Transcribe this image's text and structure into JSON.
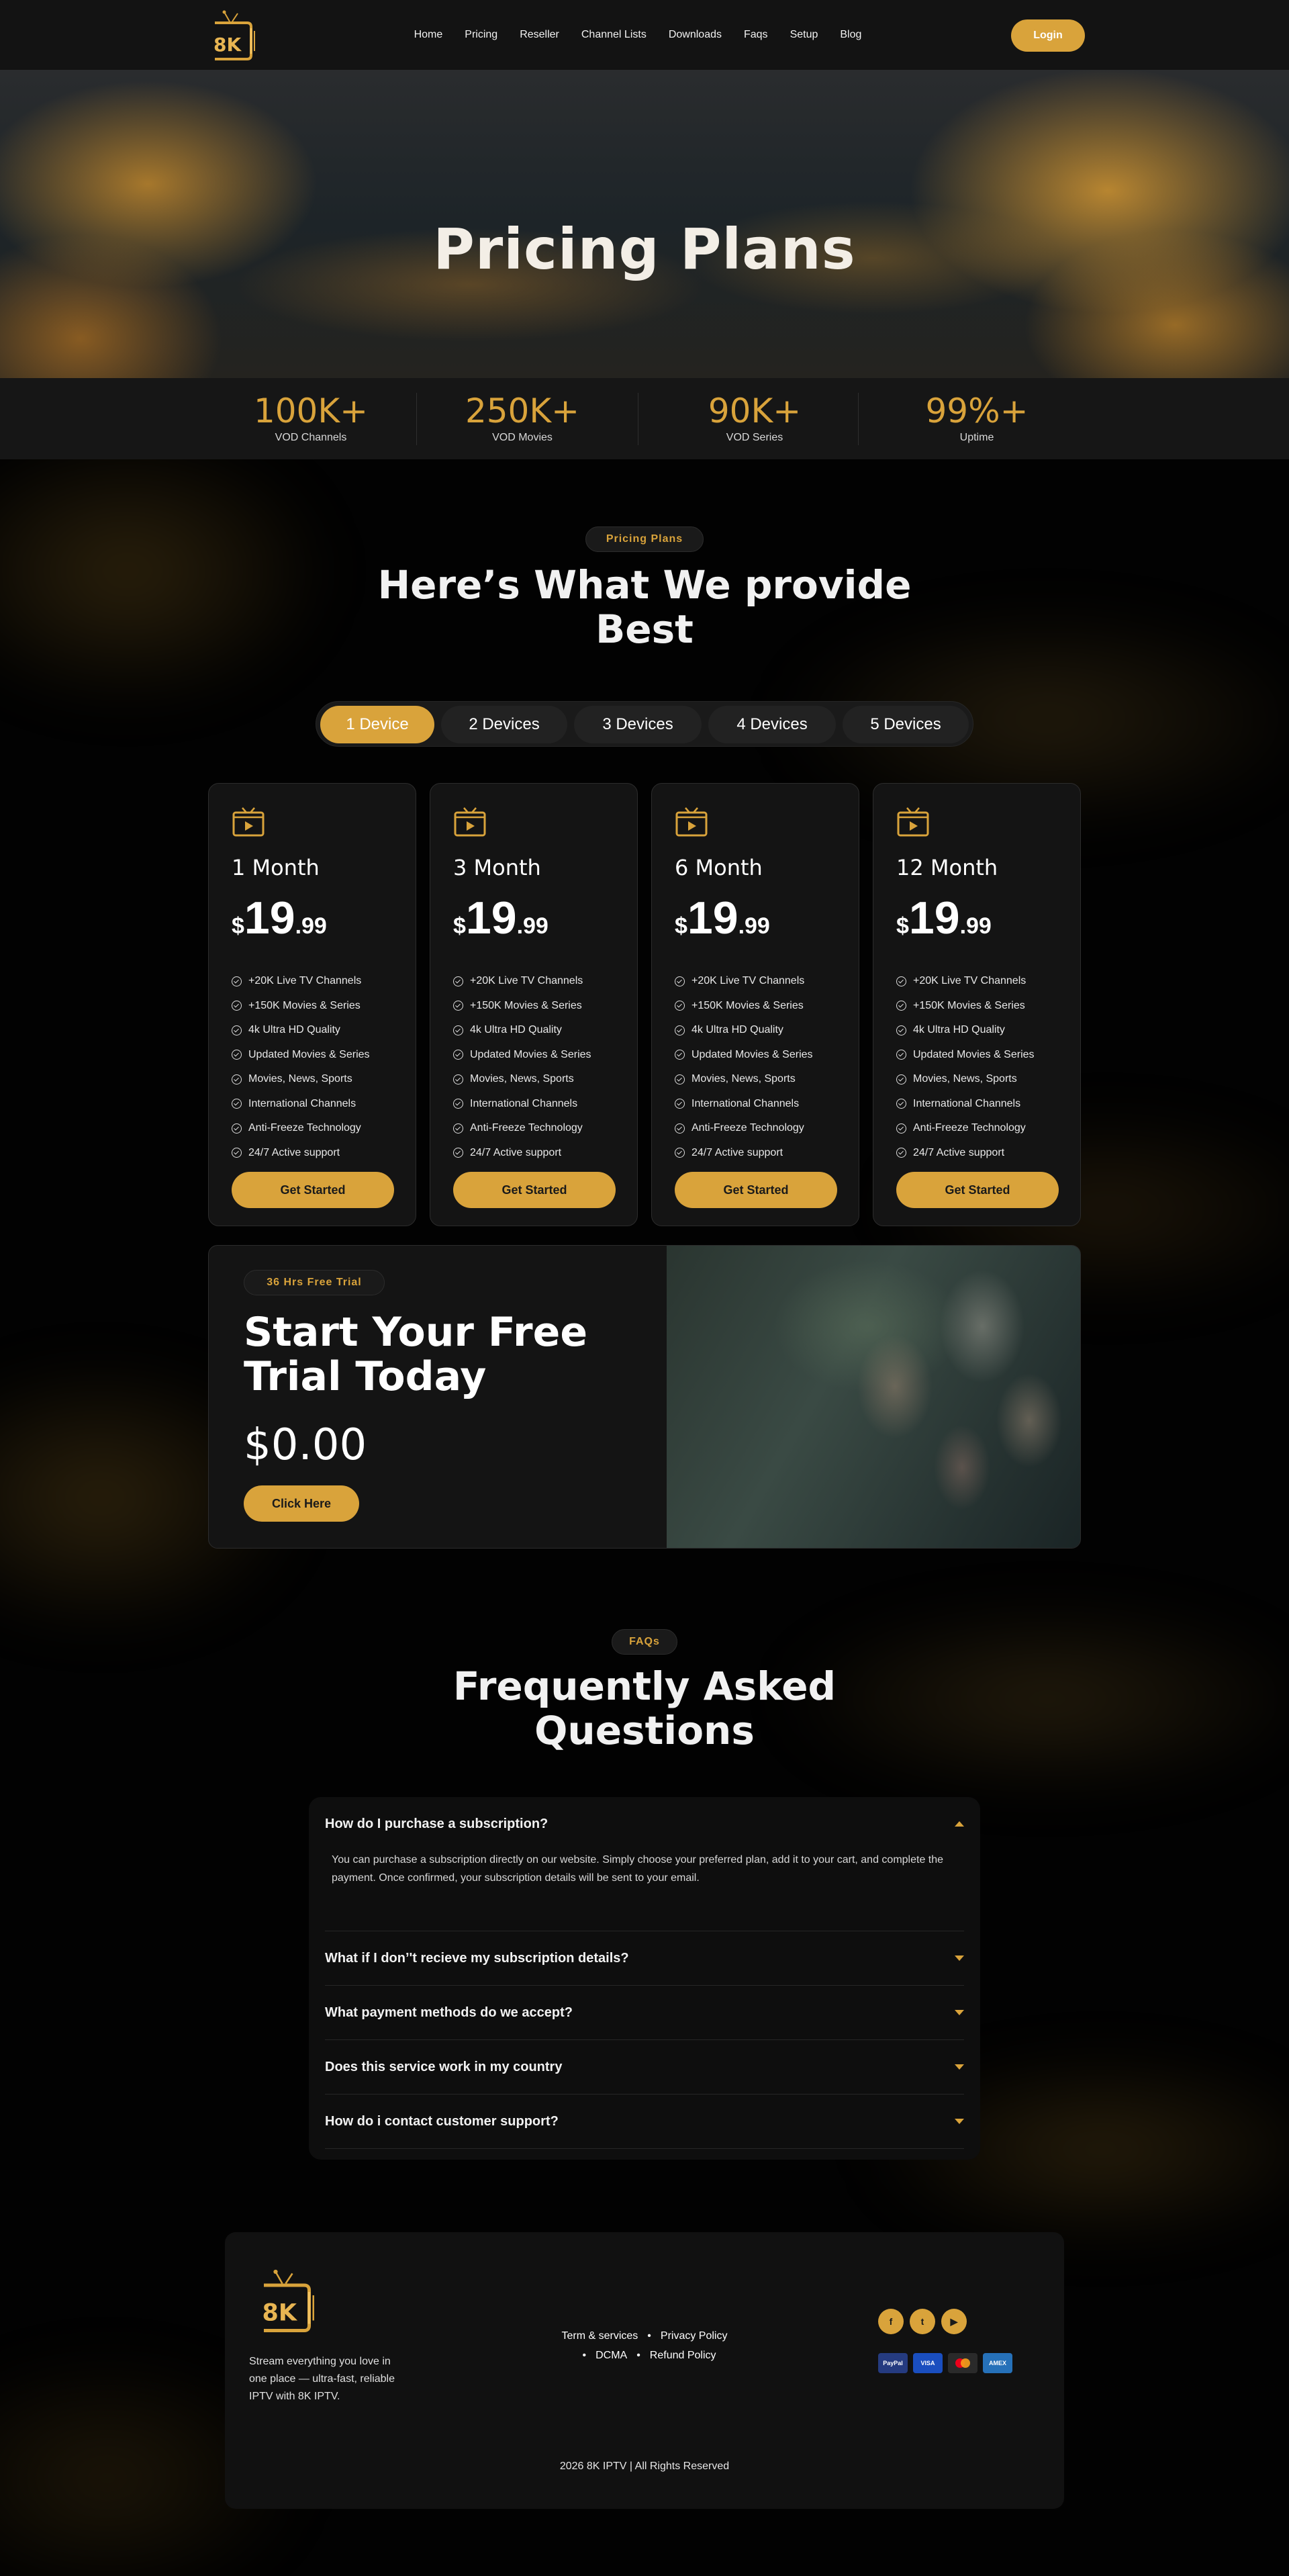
{
  "brand": {
    "logo_text": "8K",
    "accent": "#d9a33b"
  },
  "nav": {
    "links": [
      "Home",
      "Pricing",
      "Reseller",
      "Channel Lists",
      "Downloads",
      "Faqs",
      "Setup",
      "Blog"
    ],
    "login_label": "Login"
  },
  "hero": {
    "title": "Pricing Plans"
  },
  "stats": [
    {
      "value": "100K+",
      "label": "VOD Channels"
    },
    {
      "value": "250K+",
      "label": "VOD Movies"
    },
    {
      "value": "90K+",
      "label": "VOD Series"
    },
    {
      "value": "99%+",
      "label": "Uptime"
    }
  ],
  "pricing": {
    "pill": "Pricing Plans",
    "title_line1": "Here’s What We provide",
    "title_line2": "Best",
    "tabs": [
      "1 Device",
      "2 Devices",
      "3 Devices",
      "4 Devices",
      "5 Devices"
    ],
    "active_tab": "1 Device",
    "plans": [
      {
        "period": "1 Month",
        "currency": "$",
        "price_int": "19",
        "price_dec": ".99"
      },
      {
        "period": "3 Month",
        "currency": "$",
        "price_int": "19",
        "price_dec": ".99"
      },
      {
        "period": "6 Month",
        "currency": "$",
        "price_int": "19",
        "price_dec": ".99"
      },
      {
        "period": "12 Month",
        "currency": "$",
        "price_int": "19",
        "price_dec": ".99"
      }
    ],
    "features": [
      "+20K Live TV Channels",
      "+150K Movies & Series",
      "4k Ultra HD Quality",
      "Updated Movies & Series",
      "Movies, News, Sports",
      "International Channels",
      "Anti-Freeze Technology",
      "24/7 Active support"
    ],
    "cta_label": "Get Started"
  },
  "trial": {
    "pill": "36 Hrs Free Trial",
    "title_line1": "Start Your Free",
    "title_line2": "Trial Today",
    "price": "$0.00",
    "cta_label": "Click Here"
  },
  "faq": {
    "pill": "FAQs",
    "title_line1": "Frequently Asked",
    "title_line2": "Questions",
    "items": [
      {
        "question": "How do I purchase a subscription?",
        "answer": "You can purchase a subscription directly on our website. Simply choose your preferred plan, add it to your cart, and complete the payment. Once confirmed, your subscription details will be sent to your email.",
        "open": true
      },
      {
        "question": "What if I don’'t recieve my subscription details?",
        "open": false
      },
      {
        "question": "What payment methods do we accept?",
        "open": false
      },
      {
        "question": "Does this service work in my country",
        "open": false
      },
      {
        "question": "How do i contact customer support?",
        "open": false
      }
    ]
  },
  "footer": {
    "tagline": "Stream everything you love in one place — ultra-fast, reliable IPTV with 8K IPTV.",
    "links": [
      "Term & services",
      "Privacy Policy",
      "DCMA",
      "Refund Policy"
    ],
    "socials": [
      "facebook-icon",
      "twitter-icon",
      "youtube-icon"
    ],
    "payments": [
      "PayPal",
      "VISA",
      "mastercard",
      "AMEX"
    ],
    "copyright": "2026 8K IPTV | All Rights Reserved"
  }
}
